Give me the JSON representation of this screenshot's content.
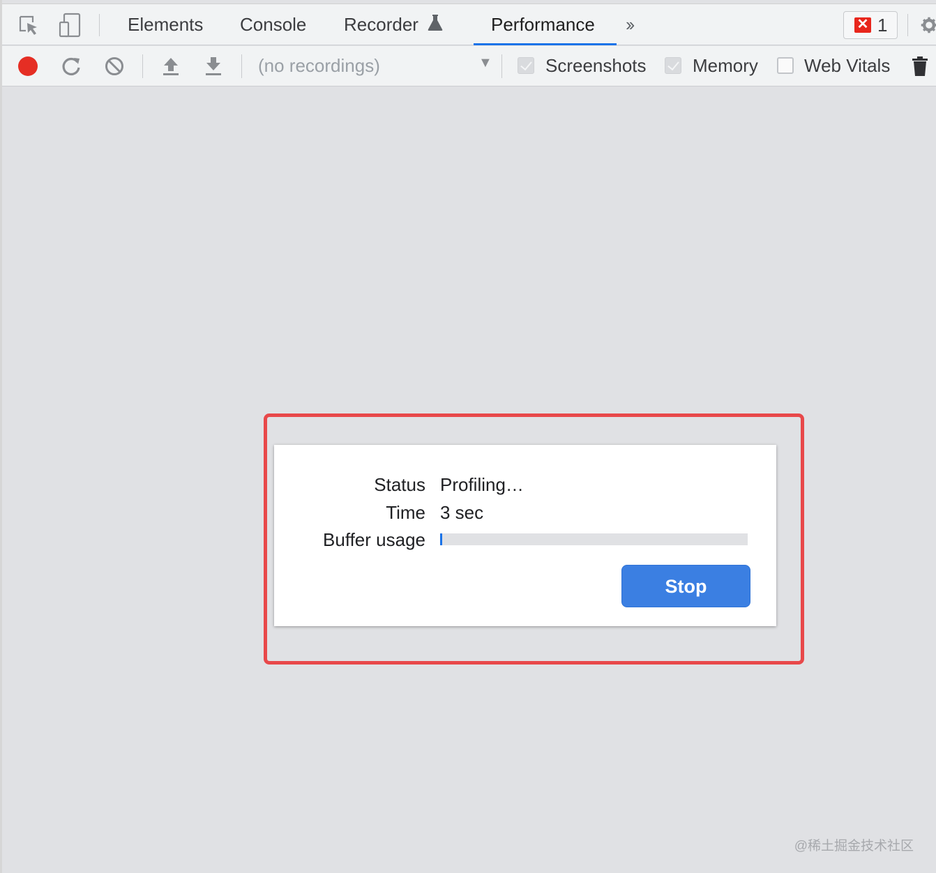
{
  "tabs": {
    "elements": "Elements",
    "console": "Console",
    "recorder": "Recorder",
    "performance": "Performance",
    "active": "Performance"
  },
  "errors": {
    "count": "1"
  },
  "toolbar": {
    "recordings_placeholder": "(no recordings)",
    "screenshots_label": "Screenshots",
    "screenshots_checked": true,
    "memory_label": "Memory",
    "memory_checked": true,
    "web_vitals_label": "Web Vitals",
    "web_vitals_checked": false
  },
  "profiling_dialog": {
    "status_label": "Status",
    "status_value": "Profiling…",
    "time_label": "Time",
    "time_value": "3 sec",
    "buffer_label": "Buffer usage",
    "buffer_usage_percent": 0.7,
    "stop_label": "Stop"
  },
  "watermark": "@稀土掘金技术社区",
  "colors": {
    "accent": "#1a73e8",
    "record": "#e52e24",
    "highlight_border": "#e8484a",
    "stop_button": "#3b7fe2"
  }
}
